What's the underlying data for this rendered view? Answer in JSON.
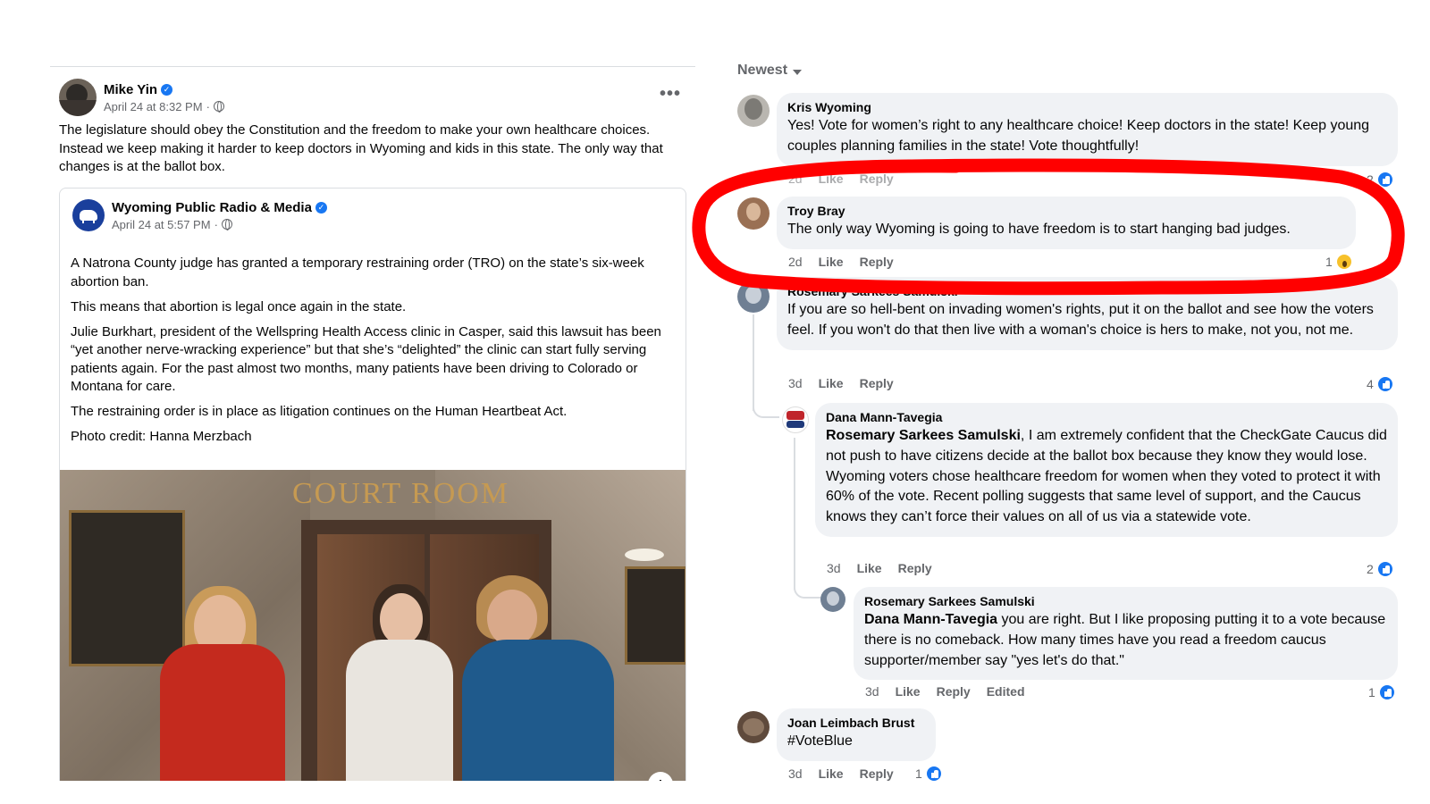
{
  "post": {
    "author": "Mike Yin",
    "timestamp": "April 24 at 8:32 PM",
    "separator": "·",
    "more_label": "•••",
    "text": "The legislature should obey the Constitution and the freedom to make your own healthcare choices. Instead we keep making it harder to keep doctors in Wyoming and kids in this state. The only way that changes is at the ballot box."
  },
  "shared_post": {
    "author": "Wyoming Public Radio & Media",
    "timestamp": "April 24 at 5:57 PM",
    "separator": "·",
    "paragraphs": [
      "A Natrona County judge has granted a temporary restraining order (TRO) on the state’s six-week abortion ban.",
      "This means that abortion is legal once again in the state.",
      "Julie Burkhart, president of the Wellspring Health Access clinic in Casper, said this lawsuit has been “yet another nerve-wracking experience” but that she’s “delighted” the clinic can start fully serving patients again. For the past almost two months, many patients have been driving to Colorado or Montana for care.",
      "The restraining order is in place as litigation continues on the Human Heartbeat Act.",
      "Photo credit: Hanna Merzbach"
    ],
    "photo_sign": "COURT ROOM",
    "info_label": "i"
  },
  "comments_panel": {
    "sort_label": "Newest",
    "action_labels": {
      "like": "Like",
      "reply": "Reply",
      "edited": "Edited"
    },
    "comments": [
      {
        "name": "Kris Wyoming",
        "text": "Yes! Vote for women’s right to any healthcare choice! Keep doctors in the state! Keep young couples planning families in the state! Vote thoughtfully!",
        "age": "2d",
        "reaction_count": "2",
        "reaction": "like-icon"
      },
      {
        "name": "Troy Bray",
        "text": "The only way Wyoming is going to have freedom is to start hanging bad judges.",
        "age": "2d",
        "reaction_count": "1",
        "reaction": "wow-icon"
      },
      {
        "name": "Rosemary Sarkees Samulski",
        "text": "If you are so hell-bent on invading women's rights, put it on the ballot and see how the voters feel. If you won't do that then live with a woman's choice is hers to make, not you, not me.",
        "age": "3d",
        "reaction_count": "4",
        "reaction": "like-icon"
      },
      {
        "name": "Dana Mann-Tavegia",
        "mention": "Rosemary Sarkees Samulski",
        "text": ", I am extremely confident that the CheckGate Caucus did not push to have citizens decide at the ballot box because they know they would lose. Wyoming voters chose healthcare freedom for women when they voted to protect it with 60% of the vote. Recent polling suggests that same level of support, and the Caucus knows they can’t force their values on all of us via a statewide vote.",
        "age": "3d",
        "reaction_count": "2",
        "reaction": "like-icon"
      },
      {
        "name": "Rosemary Sarkees Samulski",
        "mention": "Dana Mann-Tavegia",
        "text": " you are right. But I like proposing putting it to a vote because there is no comeback. How many times have you read a freedom caucus supporter/member say \"yes let's do that.\"",
        "age": "3d",
        "reaction_count": "1",
        "reaction": "like-icon"
      },
      {
        "name": "Joan Leimbach Brust",
        "text": "#VoteBlue",
        "age": "3d",
        "reaction_count": "1",
        "reaction": "like-icon"
      }
    ]
  },
  "colors": {
    "accent": "#1877f2",
    "bubble": "#f0f2f5",
    "secondary_text": "#65676b",
    "annotation_red": "#ff0000"
  }
}
